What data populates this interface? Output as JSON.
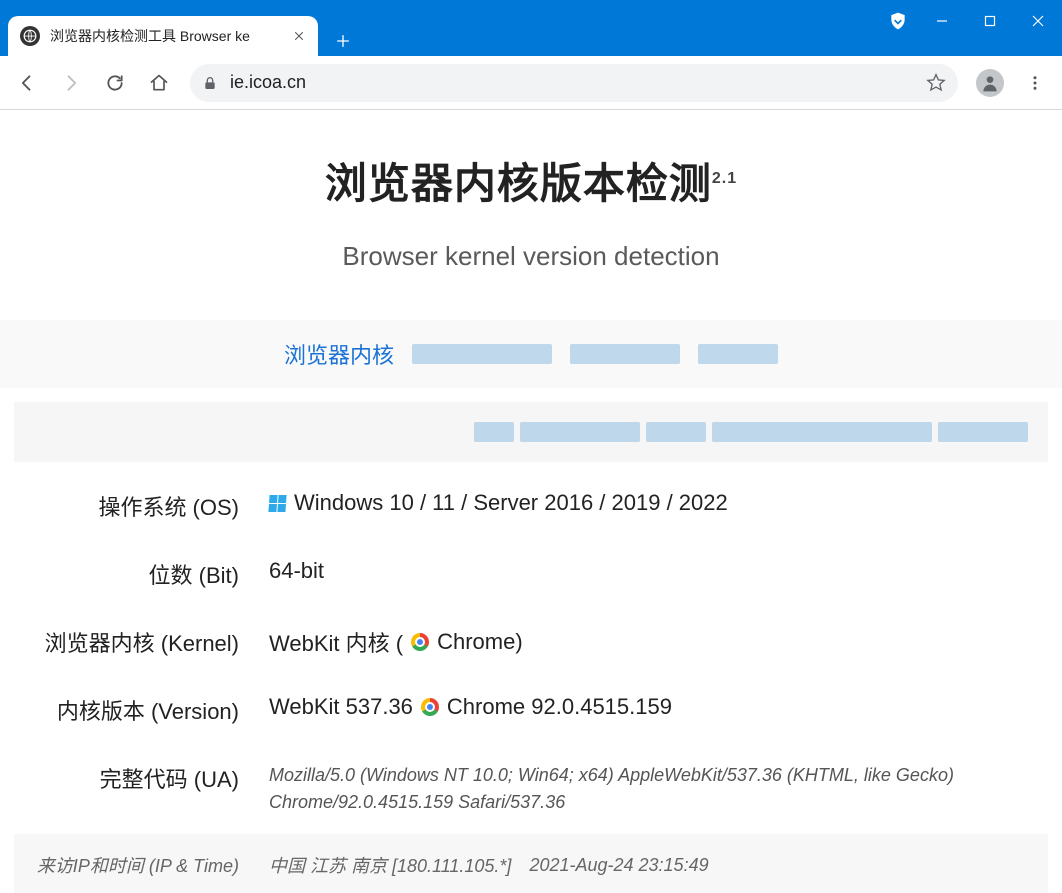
{
  "browser": {
    "tab_title": "浏览器内核检测工具 Browser ke",
    "url_display": "ie.icoa.cn"
  },
  "page": {
    "title": "浏览器内核版本检测",
    "title_sup": "2.1",
    "subtitle": "Browser kernel version detection",
    "nav_link": "浏览器内核"
  },
  "details": {
    "os_label": "操作系统 (OS)",
    "os_value": "Windows 10 / 11 / Server 2016 / 2019 / 2022",
    "bit_label": "位数 (Bit)",
    "bit_value": "64-bit",
    "kernel_label": "浏览器内核 (Kernel)",
    "kernel_value_prefix": "WebKit 内核 (",
    "kernel_value_browser": " Chrome)",
    "version_label": "内核版本 (Version)",
    "version_value_prefix": "WebKit 537.36 ",
    "version_value_browser": " Chrome 92.0.4515.159",
    "ua_label": "完整代码 (UA)",
    "ua_value": "Mozilla/5.0 (Windows NT 10.0; Win64; x64) AppleWebKit/537.36 (KHTML, like Gecko) Chrome/92.0.4515.159 Safari/537.36",
    "ip_label": "来访IP和时间 (IP & Time)",
    "ip_location": "中国 江苏 南京 [180.111.105.*]",
    "ip_time": "2021-Aug-24 23:15:49"
  }
}
